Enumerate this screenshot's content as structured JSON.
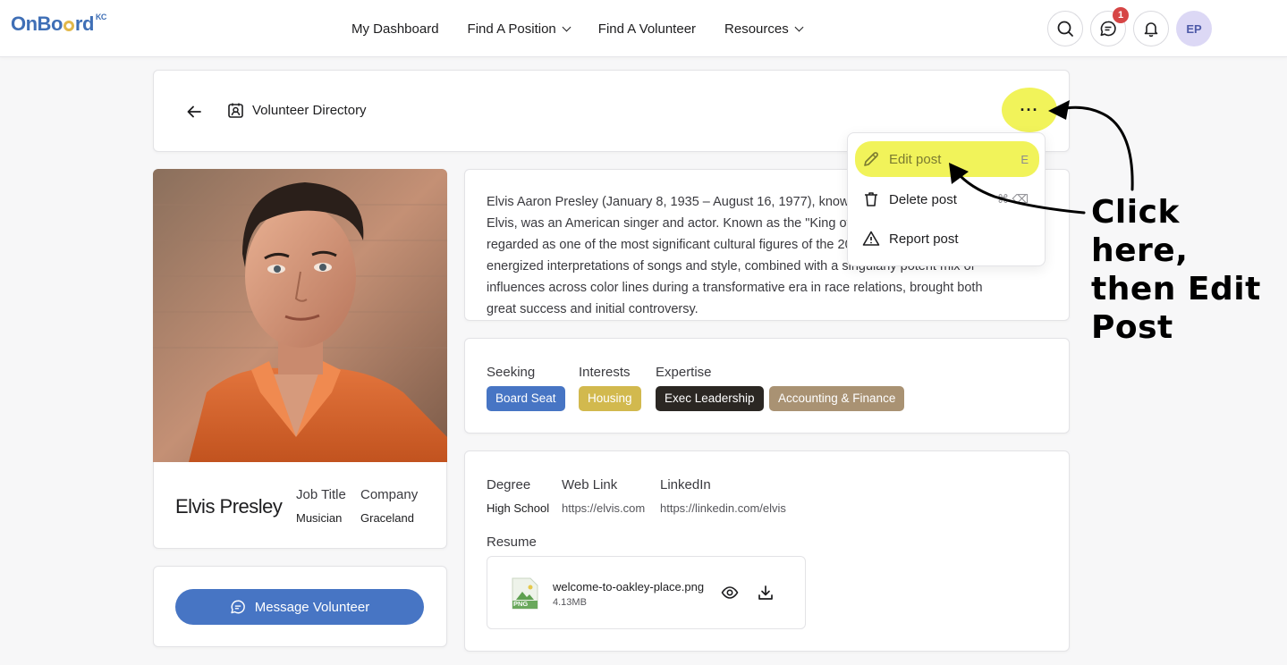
{
  "app": {
    "logo_text": "OnBoard",
    "logo_super": "KC"
  },
  "nav": {
    "items": [
      {
        "label": "My Dashboard",
        "has_dropdown": false
      },
      {
        "label": "Find A Position",
        "has_dropdown": true
      },
      {
        "label": "Find A Volunteer",
        "has_dropdown": false
      },
      {
        "label": "Resources",
        "has_dropdown": true
      }
    ],
    "message_badge": "1",
    "avatar_initials": "EP"
  },
  "header": {
    "title": "Volunteer Directory",
    "more_label": "···"
  },
  "menu": {
    "items": [
      {
        "label": "Edit post",
        "shortcut": "E",
        "icon": "pencil-icon"
      },
      {
        "label": "Delete post",
        "shortcut": "⌘ ⌫",
        "icon": "trash-icon"
      },
      {
        "label": "Report post",
        "shortcut": "",
        "icon": "warning-icon"
      }
    ]
  },
  "profile": {
    "name": "Elvis Presley",
    "job_title_label": "Job Title",
    "job_title": "Musician",
    "company_label": "Company",
    "company": "Graceland",
    "bio": "Elvis Aaron Presley (January 8, 1935 – August 16, 1977), known mononymously as Elvis, was an American singer and actor. Known as the \"King of Rock and Roll\", he is regarded as one of the most significant cultural figures of the 20th century. Presley's energized interpretations of songs and style, combined with a singularly potent mix of influences across color lines during a transformative era in race relations, brought both great success and initial controversy."
  },
  "tags": {
    "seeking_label": "Seeking",
    "interests_label": "Interests",
    "expertise_label": "Expertise",
    "seeking": "Board Seat",
    "interests": "Housing",
    "expertise": [
      "Exec Leadership",
      "Accounting & Finance"
    ],
    "colors": {
      "seeking": "#4775c4",
      "interests": "#d2b94e",
      "expertise_1": "#2b2723",
      "expertise_2": "#a99273"
    }
  },
  "details": {
    "degree_label": "Degree",
    "degree": "High School",
    "weblink_label": "Web Link",
    "weblink": "https://elvis.com",
    "linkedin_label": "LinkedIn",
    "linkedin": "https://linkedin.com/elvis",
    "resume_label": "Resume",
    "resume_file": "welcome-to-oakley-place.png",
    "resume_size": "4.13MB",
    "resume_type": "PNG"
  },
  "actions": {
    "message_label": "Message Volunteer"
  },
  "annotation": {
    "line1": "Click here,",
    "line2": "then Edit",
    "line3": "Post"
  }
}
